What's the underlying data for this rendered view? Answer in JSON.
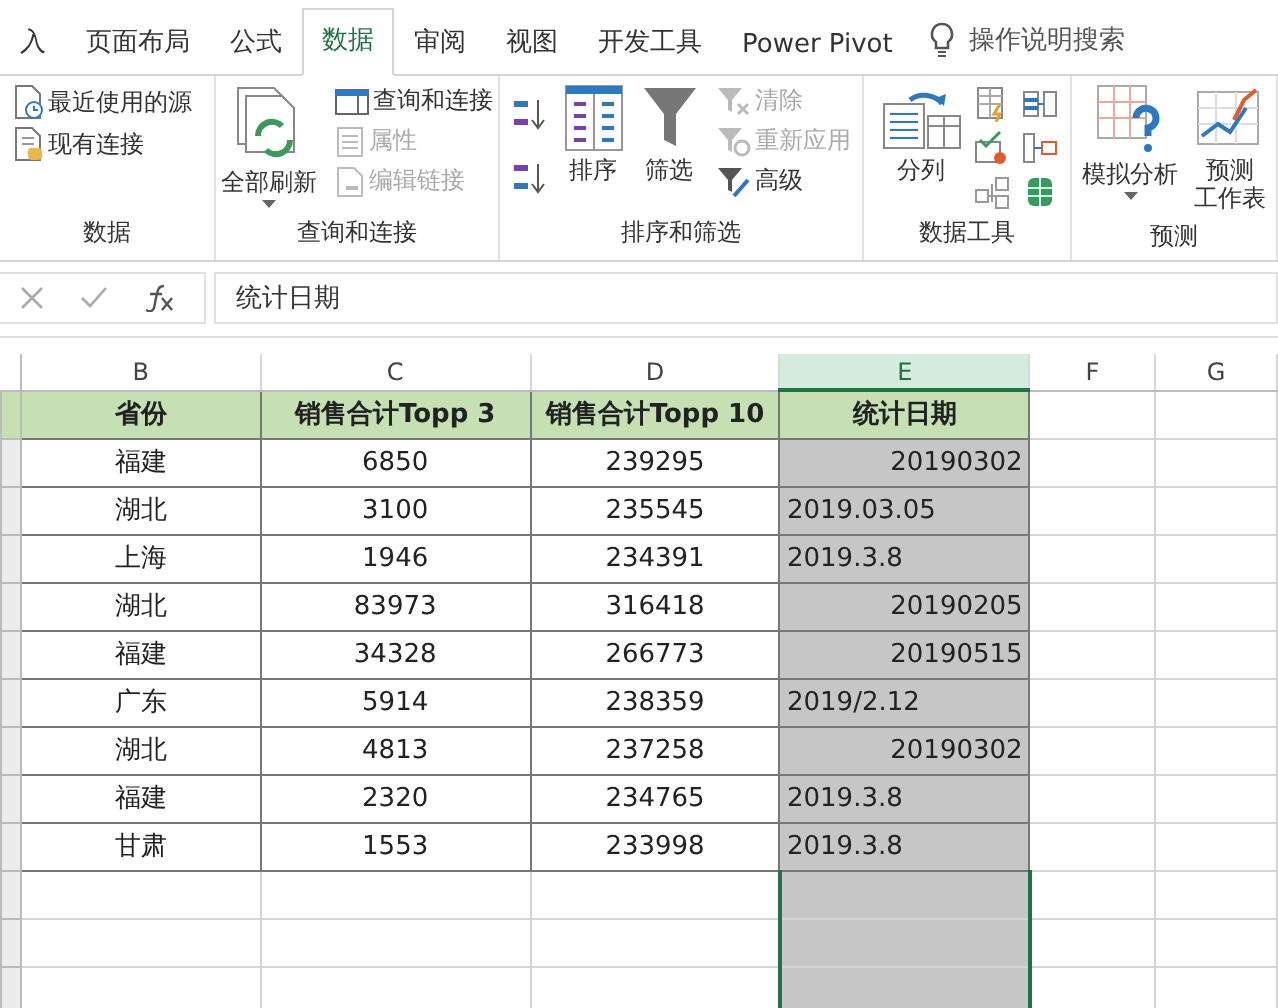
{
  "tabs": [
    {
      "label": "入",
      "selected": false
    },
    {
      "label": "页面布局",
      "selected": false
    },
    {
      "label": "公式",
      "selected": false
    },
    {
      "label": "数据",
      "selected": true
    },
    {
      "label": "审阅",
      "selected": false
    },
    {
      "label": "视图",
      "selected": false
    },
    {
      "label": "开发工具",
      "selected": false
    },
    {
      "label": "Power Pivot",
      "selected": false
    }
  ],
  "tell_me": {
    "placeholder": "操作说明搜索"
  },
  "ribbon_groups": [
    {
      "label": "数据",
      "items": [
        {
          "kind": "small",
          "label": "最近使用的源",
          "disabled": false
        },
        {
          "kind": "small",
          "label": "现有连接",
          "disabled": false
        }
      ]
    },
    {
      "label": "查询和连接",
      "items": [
        {
          "kind": "big",
          "label": [
            "全部刷新"
          ],
          "dropdown": true
        },
        {
          "kind": "stack",
          "items": [
            {
              "label": "查询和连接",
              "disabled": false
            },
            {
              "label": "属性",
              "disabled": true
            },
            {
              "label": "编辑链接",
              "disabled": true
            }
          ]
        }
      ]
    },
    {
      "label": "排序和筛选",
      "items": [
        {
          "kind": "sortpair"
        },
        {
          "kind": "big",
          "label": [
            "排序"
          ],
          "dropdown": false
        },
        {
          "kind": "big",
          "label": [
            "筛选"
          ],
          "dropdown": false
        },
        {
          "kind": "stack",
          "items": [
            {
              "label": "清除",
              "disabled": true
            },
            {
              "label": "重新应用",
              "disabled": true
            },
            {
              "label": "高级",
              "disabled": false
            }
          ]
        }
      ]
    },
    {
      "label": "数据工具",
      "items": [
        {
          "kind": "big",
          "label": [
            "分列"
          ],
          "dropdown": false
        },
        {
          "kind": "tools"
        }
      ]
    },
    {
      "label": "预测",
      "items": [
        {
          "kind": "big",
          "label": [
            "模拟分析"
          ],
          "dropdown": true
        },
        {
          "kind": "big",
          "label": [
            "预测",
            "工作表"
          ],
          "dropdown": false
        }
      ]
    }
  ],
  "formula_bar": {
    "value": "统计日期"
  },
  "columns": [
    {
      "label": "B",
      "selected": false
    },
    {
      "label": "C",
      "selected": false
    },
    {
      "label": "D",
      "selected": false
    },
    {
      "label": "E",
      "selected": true
    },
    {
      "label": "F",
      "selected": false
    },
    {
      "label": "G",
      "selected": false
    }
  ],
  "table": {
    "headers": [
      "省份",
      "销售合计Topp 3",
      "销售合计Topp 10",
      "统计日期"
    ],
    "rows": [
      [
        "福建",
        "6850",
        "239295",
        {
          "text": "20190302",
          "kind": "number"
        }
      ],
      [
        "湖北",
        "3100",
        "235545",
        {
          "text": "2019.03.05",
          "kind": "text"
        }
      ],
      [
        "上海",
        "1946",
        "234391",
        {
          "text": "2019.3.8",
          "kind": "text"
        }
      ],
      [
        "湖北",
        "83973",
        "316418",
        {
          "text": "20190205",
          "kind": "number"
        }
      ],
      [
        "福建",
        "34328",
        "266773",
        {
          "text": "20190515",
          "kind": "number"
        }
      ],
      [
        "广东",
        "5914",
        "238359",
        {
          "text": "2019/2.12",
          "kind": "text"
        }
      ],
      [
        "湖北",
        "4813",
        "237258",
        {
          "text": "20190302",
          "kind": "number"
        }
      ],
      [
        "福建",
        "2320",
        "234765",
        {
          "text": "2019.3.8",
          "kind": "text"
        }
      ],
      [
        "甘肃",
        "1553",
        "233998",
        {
          "text": "2019.3.8",
          "kind": "text"
        }
      ]
    ]
  }
}
